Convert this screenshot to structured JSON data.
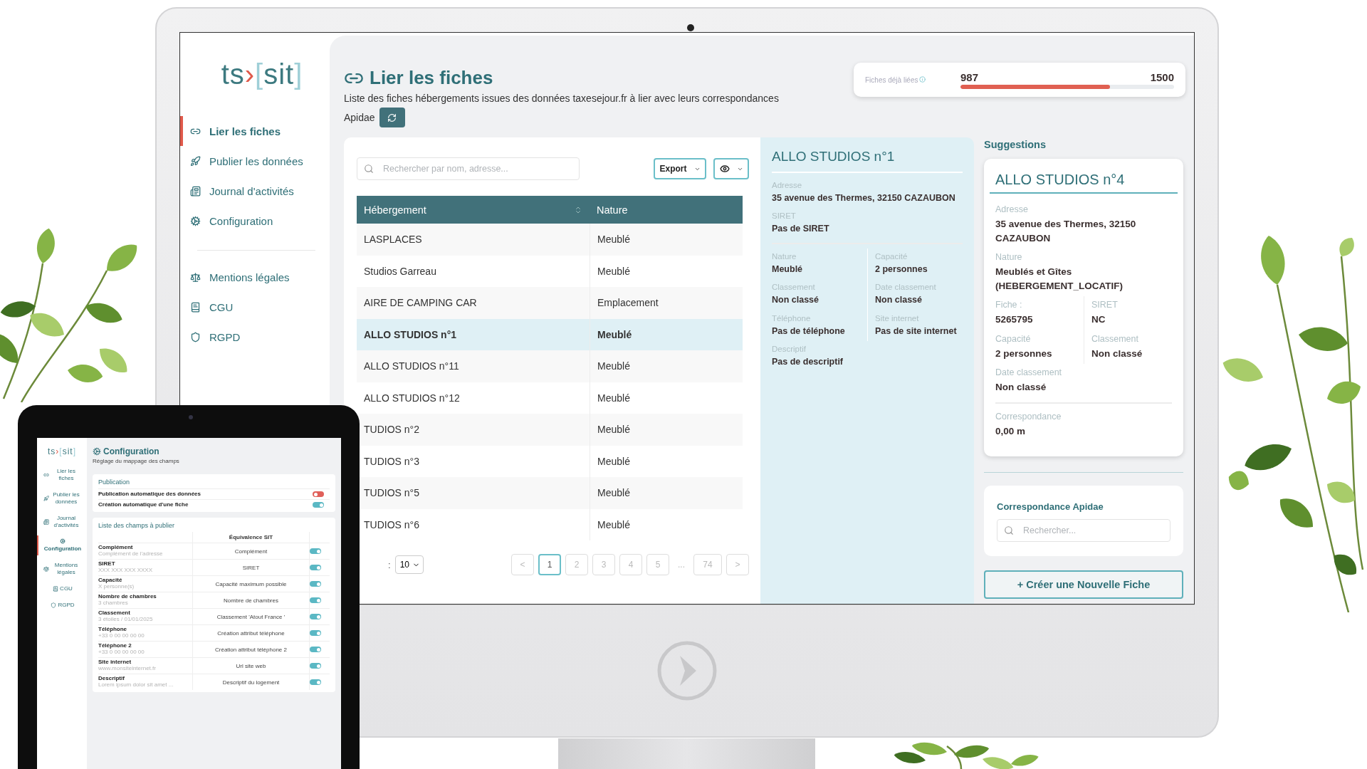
{
  "sidebar": {
    "logo": {
      "prefix": "ts",
      "arrow": "›",
      "open": "[",
      "name": "sit",
      "close": "]"
    },
    "nav": [
      {
        "label": "Lier les fiches",
        "selected": true
      },
      {
        "label": "Publier les données",
        "selected": false
      },
      {
        "label": "Journal d'activités",
        "selected": false
      },
      {
        "label": "Configuration",
        "selected": false
      }
    ],
    "legal": [
      {
        "label": "Mentions légales",
        "selected": false
      },
      {
        "label": "CGU",
        "selected": false
      },
      {
        "label": "RGPD",
        "selected": false
      }
    ]
  },
  "header": {
    "title": "Lier les fiches",
    "description": "Liste des fiches hébergements issues des données taxesejour.fr à lier avec leurs correspondances",
    "description_end": "Apidae"
  },
  "stat": {
    "label": "Fiches déjà liées",
    "value": "987",
    "total": "1500",
    "level": 0.7
  },
  "table": {
    "search_placeholder": "Rechercher par nom, adresse...",
    "export": "Export",
    "columns": [
      "Hébergement",
      "Nature"
    ],
    "rows": [
      {
        "name": "LASPLACES",
        "nature": "Meublé",
        "selected": false
      },
      {
        "name": "Studios Garreau",
        "nature": "Meublé",
        "selected": false
      },
      {
        "name": "AIRE DE CAMPING CAR",
        "nature": "Emplacement",
        "selected": false
      },
      {
        "name": "ALLO STUDIOS n°1",
        "nature": "Meublé",
        "selected": true
      },
      {
        "name": "ALLO STUDIOS n°11",
        "nature": "Meublé",
        "selected": false
      },
      {
        "name": "ALLO STUDIOS n°12",
        "nature": "Meublé",
        "selected": false
      },
      {
        "name": "TUDIOS n°2",
        "nature": "Meublé",
        "selected": false
      },
      {
        "name": "TUDIOS n°3",
        "nature": "Meublé",
        "selected": false
      },
      {
        "name": "TUDIOS n°5",
        "nature": "Meublé",
        "selected": false
      },
      {
        "name": "TUDIOS n°6",
        "nature": "Meublé",
        "selected": false
      }
    ],
    "page_size_label": ":",
    "page_size": "10",
    "prev": "<",
    "next": ">",
    "ellipsis": "...",
    "pages": [
      {
        "label": "1",
        "selected": true
      },
      {
        "label": "2",
        "selected": false
      },
      {
        "label": "3",
        "selected": false
      },
      {
        "label": "4",
        "selected": false
      },
      {
        "label": "5",
        "selected": false
      }
    ],
    "last_page": {
      "label": "74",
      "selected": false
    }
  },
  "detail": {
    "title": "ALLO STUDIOS n°1",
    "sections": [
      {
        "fields": [
          {
            "label": "Adresse",
            "value": "35 avenue des Thermes, 32150 CAZAUBON",
            "kind": "full"
          },
          {
            "label": "SIRET",
            "value": "Pas de SIRET",
            "kind": "full"
          }
        ]
      },
      {
        "fields": [
          {
            "label": "Nature",
            "value": "Meublé",
            "kind": "left"
          },
          {
            "label": "Capacité",
            "value": "2 personnes",
            "kind": "right"
          },
          {
            "label": "Classement",
            "value": "Non classé",
            "kind": "left"
          },
          {
            "label": "Date classement",
            "value": "Non classé",
            "kind": "right"
          },
          {
            "label": "Téléphone",
            "value": "Pas de téléphone",
            "kind": "left"
          },
          {
            "label": "Site internet",
            "value": "Pas de site internet",
            "kind": "right"
          },
          {
            "label": "Descriptif",
            "value": "Pas de descriptif",
            "kind": "full"
          }
        ]
      }
    ]
  },
  "suggestions": {
    "title": "Suggestions",
    "card": {
      "title": "ALLO STUDIOS n°4",
      "sections": [
        {
          "fields": [
            {
              "label": "Adresse",
              "value": "35 avenue des Thermes, 32150 CAZAUBON",
              "kind": "full"
            },
            {
              "label": "Nature",
              "value": "Meublés et Gîtes (HEBERGEMENT_LOCATIF)",
              "kind": "full"
            },
            {
              "label": "Fiche :",
              "value": "5265795",
              "kind": "left"
            },
            {
              "label": "SIRET",
              "value": "NC",
              "kind": "right"
            },
            {
              "label": "Capacité",
              "value": "2 personnes",
              "kind": "left"
            },
            {
              "label": "Classement",
              "value": "Non classé",
              "kind": "right"
            },
            {
              "label": "Date classement",
              "value": "Non classé",
              "kind": "full"
            }
          ]
        },
        {
          "fields": [
            {
              "label": "Correspondance",
              "value": "0,00 m",
              "kind": "full"
            }
          ]
        }
      ]
    },
    "apidae": {
      "title": "Correspondance Apidae",
      "placeholder": "Rechercher..."
    },
    "create_button": "+ Créer une Nouvelle Fiche"
  },
  "tablet": {
    "logo": {
      "prefix": "ts",
      "arrow": "›",
      "open": "[",
      "name": "sit",
      "close": "]"
    },
    "nav": [
      {
        "label": "Lier les fiches",
        "selected": false
      },
      {
        "label": "Publier les données",
        "selected": false
      },
      {
        "label": "Journal d'activités",
        "selected": false
      },
      {
        "label": "Configuration",
        "selected": true
      },
      {
        "label": "Mentions légales",
        "selected": false
      },
      {
        "label": "CGU",
        "selected": false
      },
      {
        "label": "RGPD",
        "selected": false
      }
    ],
    "title": "Configuration",
    "subtitle": "Réglage du mappage des champs",
    "publication": {
      "title": "Publication",
      "toggles": [
        {
          "label": "Publication automatique des données",
          "on": false
        },
        {
          "label": "Création automatique d'une fiche",
          "on": true
        }
      ]
    },
    "fields": {
      "title": "Liste des champs à publier",
      "column": "Équivalence SIT",
      "rows": [
        {
          "name": "Complément",
          "hint": "Complément de l'adresse",
          "equivalent": "Complément",
          "on": true
        },
        {
          "name": "SIRET",
          "hint": "XXX XXX XXX XXXX",
          "equivalent": "SIRET",
          "on": true
        },
        {
          "name": "Capacité",
          "hint": "X personne(s)",
          "equivalent": "Capacité maximum possible",
          "on": true
        },
        {
          "name": "Nombre de chambres",
          "hint": "3 chambres",
          "equivalent": "Nombre de chambres",
          "on": true
        },
        {
          "name": "Classement",
          "hint": "3 étoiles / 01/01/2025",
          "equivalent": "Classement 'Atout France '",
          "on": true
        },
        {
          "name": "Téléphone",
          "hint": "+33 0 00 00 00 00",
          "equivalent": "Création attribut téléphone",
          "on": true
        },
        {
          "name": "Téléphone 2",
          "hint": "+33 0 00 00 00 00",
          "equivalent": "Création attribut téléphone 2",
          "on": true
        },
        {
          "name": "Site internet",
          "hint": "www.monsiteinternet.fr",
          "equivalent": "Url site web",
          "on": true
        },
        {
          "name": "Descriptif",
          "hint": "Lorem ipsum dolor sit amet ...",
          "equivalent": "Descriptif du logement",
          "on": true
        }
      ]
    }
  }
}
